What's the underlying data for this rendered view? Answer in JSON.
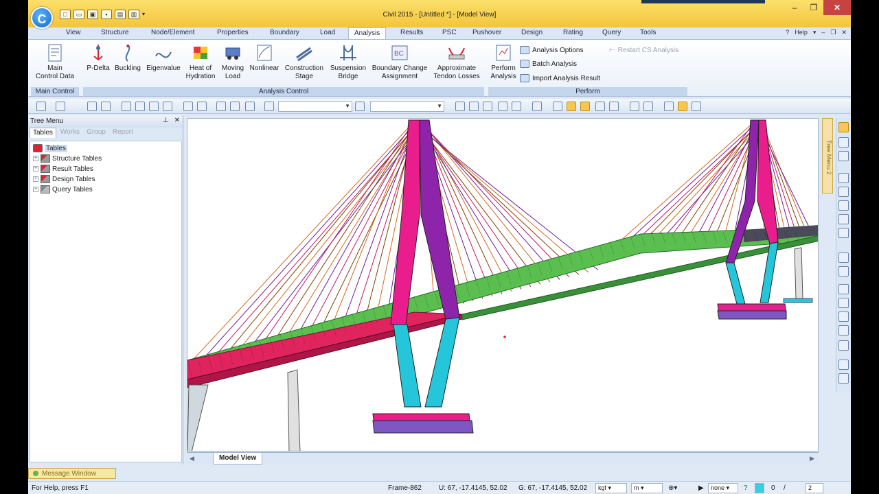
{
  "window": {
    "title": "Civil 2015 - [Untitled *] - [Model View]"
  },
  "app_logo": {
    "letter": "C"
  },
  "ribbon": {
    "tabs": [
      "View",
      "Structure",
      "Node/Element",
      "Properties",
      "Boundary",
      "Load",
      "Analysis",
      "Results",
      "PSC",
      "Pushover",
      "Design",
      "Rating",
      "Query",
      "Tools"
    ],
    "active_tab": "Analysis",
    "right_help": "Help",
    "buttons": [
      {
        "l1": "Main",
        "l2": "Control Data",
        "icon": "main-control-icon"
      },
      {
        "l1": "P-Delta",
        "l2": "",
        "icon": "p-delta-icon"
      },
      {
        "l1": "Buckling",
        "l2": "",
        "icon": "buckling-icon"
      },
      {
        "l1": "Eigenvalue",
        "l2": "",
        "icon": "eigenvalue-icon"
      },
      {
        "l1": "Heat of",
        "l2": "Hydration",
        "icon": "heat-hydration-icon"
      },
      {
        "l1": "Moving",
        "l2": "Load",
        "icon": "moving-load-icon"
      },
      {
        "l1": "Nonlinear",
        "l2": "",
        "icon": "nonlinear-icon"
      },
      {
        "l1": "Construction",
        "l2": "Stage",
        "icon": "construction-stage-icon"
      },
      {
        "l1": "Suspension",
        "l2": "Bridge",
        "icon": "suspension-bridge-icon"
      },
      {
        "l1": "Boundary Change",
        "l2": "Assignment",
        "icon": "boundary-change-icon"
      },
      {
        "l1": "Approximate",
        "l2": "Tendon Losses",
        "icon": "tendon-losses-icon"
      },
      {
        "l1": "Perform",
        "l2": "Analysis",
        "icon": "perform-analysis-icon"
      }
    ],
    "small_buttons": [
      "Analysis Options",
      "Batch Analysis",
      "Import Analysis Result"
    ],
    "restart_cs": "Restart CS Analysis",
    "groups": [
      "Main Control",
      "Analysis Control",
      "Perform"
    ]
  },
  "tree_menu": {
    "title": "Tree Menu",
    "tabs": [
      "Tables",
      "Works",
      "Group",
      "Report"
    ],
    "root": "Tables",
    "items": [
      "Structure Tables",
      "Result Tables",
      "Design Tables",
      "Query Tables"
    ]
  },
  "view": {
    "tab_label": "Model View",
    "side_tab": "Tree Menu 2",
    "colors": {
      "deck_red": "#d81b60",
      "deck_green": "#4caf50",
      "cable_orange": "#d2691e",
      "cable_purple": "#6a1b9a",
      "footing": "#e91e8c"
    }
  },
  "status": {
    "message_window": "Message Window",
    "help_text": "For Help, press F1",
    "frame": "Frame-862",
    "u_coord": "U: 67, -17.4145, 52.02",
    "g_coord": "G: 67, -17.4145, 52.02",
    "force_unit": "kgf",
    "length_unit": "m",
    "filter": "none",
    "page_current": "0",
    "page_total": "2"
  }
}
